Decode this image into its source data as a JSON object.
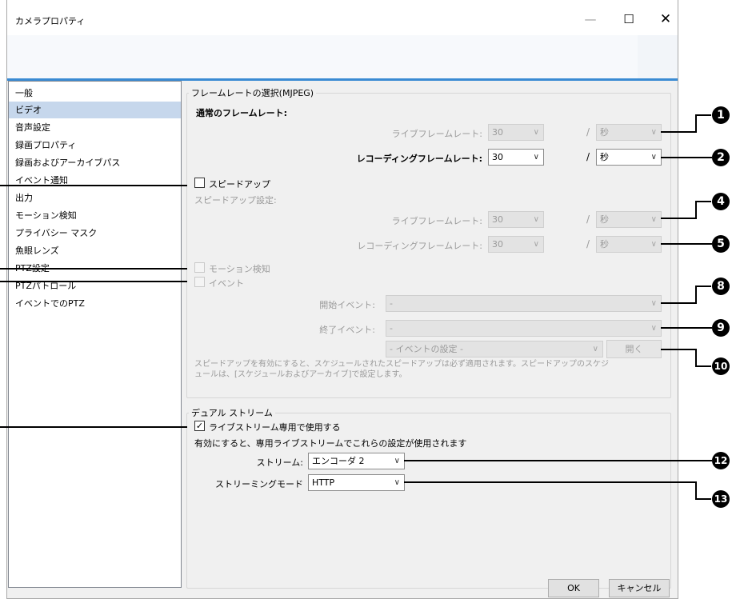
{
  "window": {
    "title": "カメラプロパティ",
    "minimize_glyph": "—",
    "maximize_glyph": "☐",
    "close_glyph": "✕"
  },
  "sidebar": {
    "items": [
      {
        "label": "一般"
      },
      {
        "label": "ビデオ"
      },
      {
        "label": "音声設定"
      },
      {
        "label": "録画プロパティ"
      },
      {
        "label": "録画およびアーカイブパス"
      },
      {
        "label": "イベント通知"
      },
      {
        "label": "出力"
      },
      {
        "label": "モーション検知"
      },
      {
        "label": "プライバシー マスク"
      },
      {
        "label": "魚眼レンズ"
      },
      {
        "label": "PTZ設定"
      },
      {
        "label": "PTZパトロール"
      },
      {
        "label": "イベントでのPTZ"
      }
    ],
    "selected_index": 1
  },
  "framerate": {
    "group_label": "フレームレートの選択(MJPEG)",
    "normal_label": "通常のフレームレート:",
    "live_label": "ライブフレームレート:",
    "live_value": "30",
    "live_unit": "秒",
    "rec_label": "レコーディングフレームレート:",
    "rec_value": "30",
    "rec_unit": "秒",
    "slash": "/",
    "speedup_label": "スピードアップ",
    "speedup_settings_label": "スピードアップ設定:",
    "su_live_label": "ライブフレームレート:",
    "su_live_value": "30",
    "su_live_unit": "秒",
    "su_rec_label": "レコーディングフレームレート:",
    "su_rec_value": "30",
    "su_rec_unit": "秒",
    "motion_label": "モーション検知",
    "event_label": "イベント",
    "start_event_label": "開始イベント:",
    "start_event_value": "-",
    "end_event_label": "終了イベント:",
    "end_event_value": "-",
    "event_settings_value": "- イベントの設定 -",
    "open_button": "開く",
    "note_line1": "スピードアップを有効にすると、スケジュールされたスピードアップは必ず適用されます。スピードアップのスケジ",
    "note_line2": "ュールは、[スケジュールおよびアーカイブ]で設定します。"
  },
  "dual_stream": {
    "group_label": "デュアル ストリーム",
    "checkbox_label": "ライブストリーム専用で使用する",
    "checkbox_checked": true,
    "desc": "有効にすると、専用ライブストリームでこれらの設定が使用されます",
    "stream_label": "ストリーム:",
    "stream_value": "エンコーダ 2",
    "mode_label": "ストリーミングモード",
    "mode_value": "HTTP"
  },
  "footer": {
    "ok": "OK",
    "cancel": "キャンセル"
  },
  "callouts": {
    "b1": "1",
    "b2": "2",
    "b4": "4",
    "b5": "5",
    "b8": "8",
    "b9": "9",
    "b10": "10",
    "b12": "12",
    "b13": "13"
  },
  "colors": {
    "accent": "#3a8bd3",
    "selection": "#c6d7ec",
    "badge": "#000000"
  }
}
